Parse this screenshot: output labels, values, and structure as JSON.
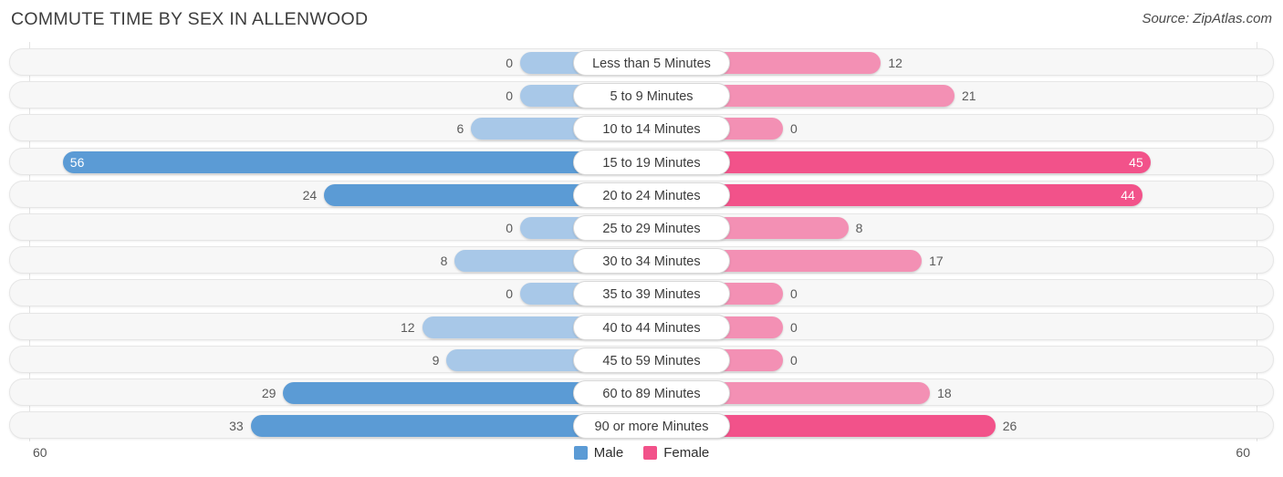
{
  "header": {
    "title": "COMMUTE TIME BY SEX IN ALLENWOOD",
    "source": "Source: ZipAtlas.com"
  },
  "legend": {
    "male_label": "Male",
    "female_label": "Female",
    "male_color": "#5b9bd5",
    "female_color": "#f2528a"
  },
  "axis": {
    "left_max_label": "60",
    "right_max_label": "60"
  },
  "chart_data": {
    "type": "bar",
    "subtype": "diverging-bidirectional-bar",
    "title": "COMMUTE TIME BY SEX IN ALLENWOOD",
    "xlabel": "",
    "ylabel": "",
    "xlim": [
      -60,
      60
    ],
    "axis_max": 60,
    "grid": true,
    "legend_position": "bottom-center",
    "categories": [
      "Less than 5 Minutes",
      "5 to 9 Minutes",
      "10 to 14 Minutes",
      "15 to 19 Minutes",
      "20 to 24 Minutes",
      "25 to 29 Minutes",
      "30 to 34 Minutes",
      "35 to 39 Minutes",
      "40 to 44 Minutes",
      "45 to 59 Minutes",
      "60 to 89 Minutes",
      "90 or more Minutes"
    ],
    "series": [
      {
        "name": "Male",
        "color": "#5b9bd5",
        "direction": "left",
        "values": [
          0,
          0,
          6,
          56,
          24,
          0,
          8,
          0,
          12,
          9,
          29,
          33
        ]
      },
      {
        "name": "Female",
        "color": "#f2528a",
        "direction": "right",
        "values": [
          12,
          21,
          0,
          45,
          44,
          8,
          17,
          0,
          0,
          0,
          18,
          26
        ]
      }
    ]
  },
  "rows": [
    {
      "label": "Less than 5 Minutes",
      "male": "0",
      "female": "12"
    },
    {
      "label": "5 to 9 Minutes",
      "male": "0",
      "female": "21"
    },
    {
      "label": "10 to 14 Minutes",
      "male": "6",
      "female": "0"
    },
    {
      "label": "15 to 19 Minutes",
      "male": "56",
      "female": "45"
    },
    {
      "label": "20 to 24 Minutes",
      "male": "24",
      "female": "44"
    },
    {
      "label": "25 to 29 Minutes",
      "male": "0",
      "female": "8"
    },
    {
      "label": "30 to 34 Minutes",
      "male": "8",
      "female": "17"
    },
    {
      "label": "35 to 39 Minutes",
      "male": "0",
      "female": "0"
    },
    {
      "label": "40 to 44 Minutes",
      "male": "12",
      "female": "0"
    },
    {
      "label": "45 to 59 Minutes",
      "male": "9",
      "female": "0"
    },
    {
      "label": "60 to 89 Minutes",
      "male": "29",
      "female": "18"
    },
    {
      "label": "90 or more Minutes",
      "male": "33",
      "female": "26"
    }
  ]
}
